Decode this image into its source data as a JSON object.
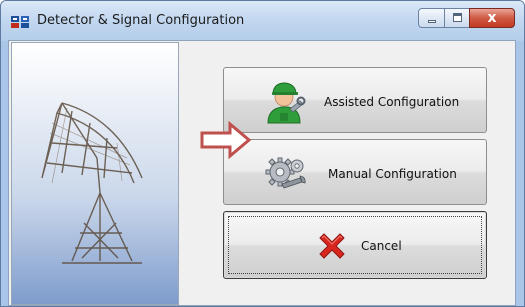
{
  "window": {
    "title": "Detector & Signal Configuration",
    "close_glyph": "x"
  },
  "buttons": {
    "assisted": {
      "label": "Assisted Configuration",
      "icon": "technician-icon"
    },
    "manual": {
      "label": "Manual Configuration",
      "icon": "gears-wrench-icon"
    },
    "cancel": {
      "label": "Cancel",
      "icon": "red-x-icon"
    }
  },
  "annotation": {
    "icon": "red-arrow-icon",
    "color": "#c0504d"
  },
  "colors": {
    "titlebar": "#c3d8f0",
    "close_button": "#c13a24",
    "cancel_x": "#d8261e"
  }
}
